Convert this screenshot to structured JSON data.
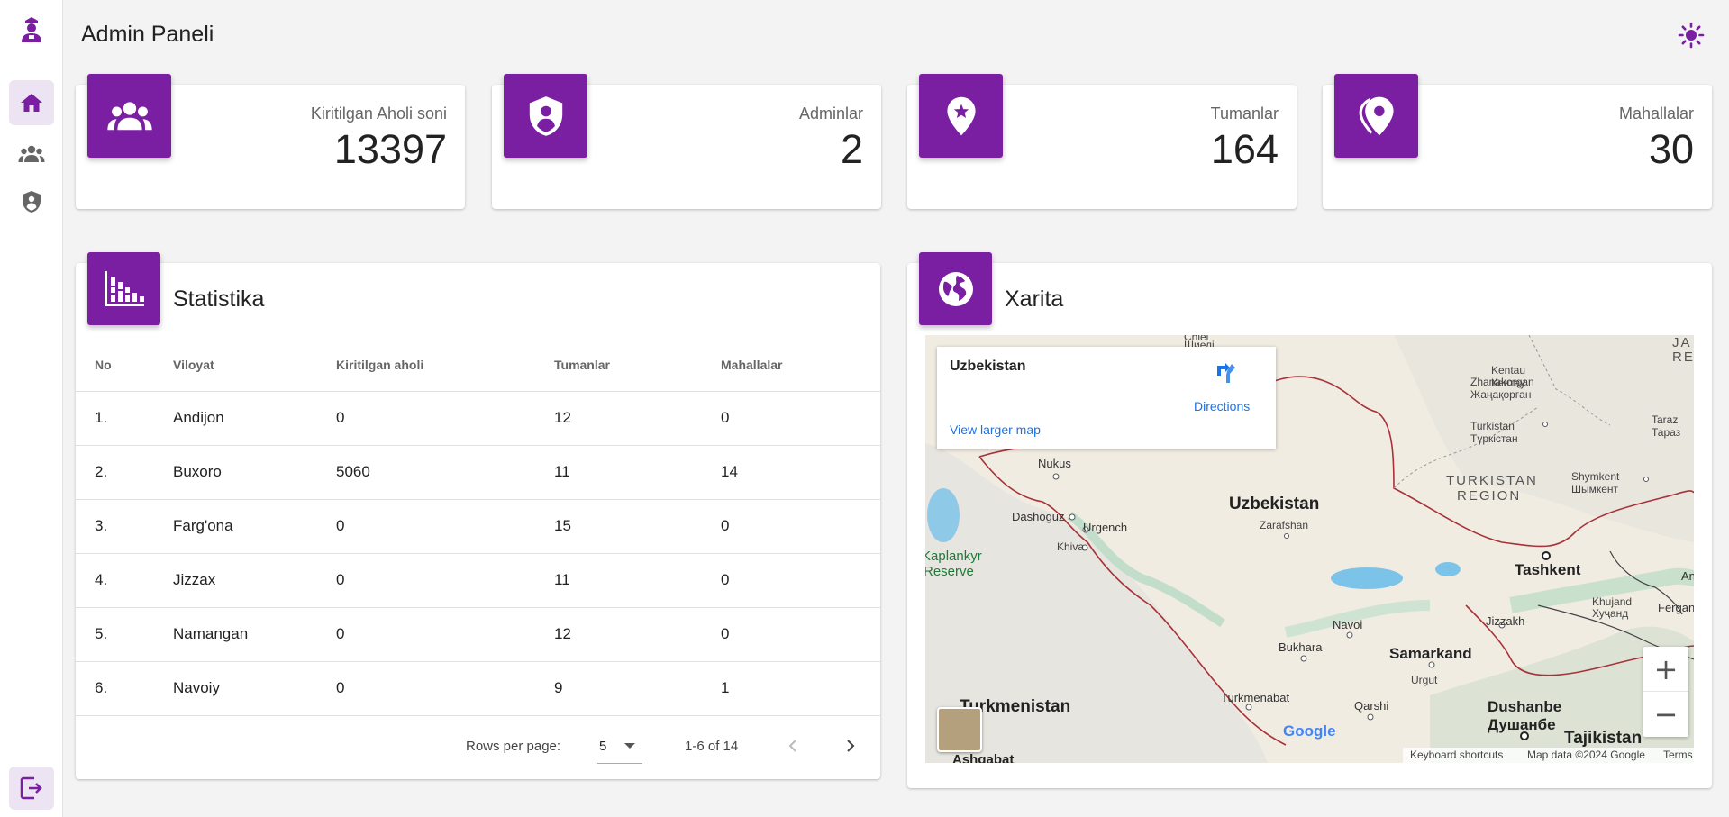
{
  "header": {
    "title": "Admin Paneli"
  },
  "sidebar": {
    "items": [
      {
        "name": "home",
        "icon": "home-icon",
        "active": true
      },
      {
        "name": "users",
        "icon": "group-icon",
        "active": false
      },
      {
        "name": "admins",
        "icon": "shield-person-icon",
        "active": false
      }
    ],
    "logout_icon": "logout-icon"
  },
  "stats": [
    {
      "label": "Kiritilgan Aholi soni",
      "value": "13397",
      "icon": "group-icon"
    },
    {
      "label": "Adminlar",
      "value": "2",
      "icon": "shield-person-icon"
    },
    {
      "label": "Tumanlar",
      "value": "164",
      "icon": "pin-star-icon"
    },
    {
      "label": "Mahallalar",
      "value": "30",
      "icon": "location-icon"
    }
  ],
  "statistika": {
    "title": "Statistika",
    "columns": [
      "No",
      "Viloyat",
      "Kiritilgan aholi",
      "Tumanlar",
      "Mahallalar"
    ],
    "rows": [
      [
        "1.",
        "Andijon",
        "0",
        "12",
        "0"
      ],
      [
        "2.",
        "Buxoro",
        "5060",
        "11",
        "14"
      ],
      [
        "3.",
        "Farg'ona",
        "0",
        "15",
        "0"
      ],
      [
        "4.",
        "Jizzax",
        "0",
        "11",
        "0"
      ],
      [
        "5.",
        "Namangan",
        "0",
        "12",
        "0"
      ],
      [
        "6.",
        "Navoiy",
        "0",
        "9",
        "1"
      ]
    ],
    "pagination": {
      "rows_per_page_label": "Rows per page:",
      "rows_per_page": "5",
      "range": "1-6 of 14"
    }
  },
  "xarita": {
    "title": "Xarita",
    "info": {
      "place": "Uzbekistan",
      "directions": "Directions",
      "larger_map": "View larger map"
    },
    "labels": {
      "shiyeli_ru": "Шиелі",
      "shiyeli_top": "Chiel",
      "zhanakorgan": "Zhanakorgan",
      "zhanakorgan_kz": "Жаңақорған",
      "kentau": "Kentau",
      "kentau_kz": "Кентау",
      "turkistan": "Turkistan",
      "turkistan_kz": "Түркістан",
      "taraz": "Taraz",
      "taraz_kz": "Тараз",
      "ja": "JA",
      "re": "RE",
      "turkistan_region_1": "TURKISTAN",
      "turkistan_region_2": "REGION",
      "shymkent": "Shymkent",
      "shymkent_kz": "Шымкент",
      "nukus": "Nukus",
      "dashoguz": "Dashoguz",
      "urgench": "Urgench",
      "khiva": "Khiva",
      "kaplankyr_1": "Kaplankyr",
      "kaplankyr_2": "Reserve",
      "uzbekistan": "Uzbekistan",
      "zarafshan": "Zarafshan",
      "tashkent": "Tashkent",
      "khujand": "Khujand",
      "khujand_tj": "Хуҷанд",
      "ferg": "Fergan",
      "an": "An",
      "jizzakh": "Jizzakh",
      "navoi": "Navoi",
      "bukhara": "Bukhara",
      "samarkand": "Samarkand",
      "urgut": "Urgut",
      "turkmenistan": "Turkmenistan",
      "turkmenabat": "Turkmenabat",
      "qarshi": "Qarshi",
      "dushanbe": "Dushanbe",
      "dushanbe_tj": "Душанбе",
      "tajikistan": "Tajikistan",
      "ashgabat": "Ashgabat"
    },
    "google": "Google",
    "footer": {
      "shortcuts": "Keyboard shortcuts",
      "data": "Map data ©2024 Google",
      "terms": "Terms"
    }
  },
  "colors": {
    "accent": "#7b1fa2",
    "accent_light": "#ede4f3",
    "background": "#f3f3f4",
    "link": "#1a73e8"
  }
}
